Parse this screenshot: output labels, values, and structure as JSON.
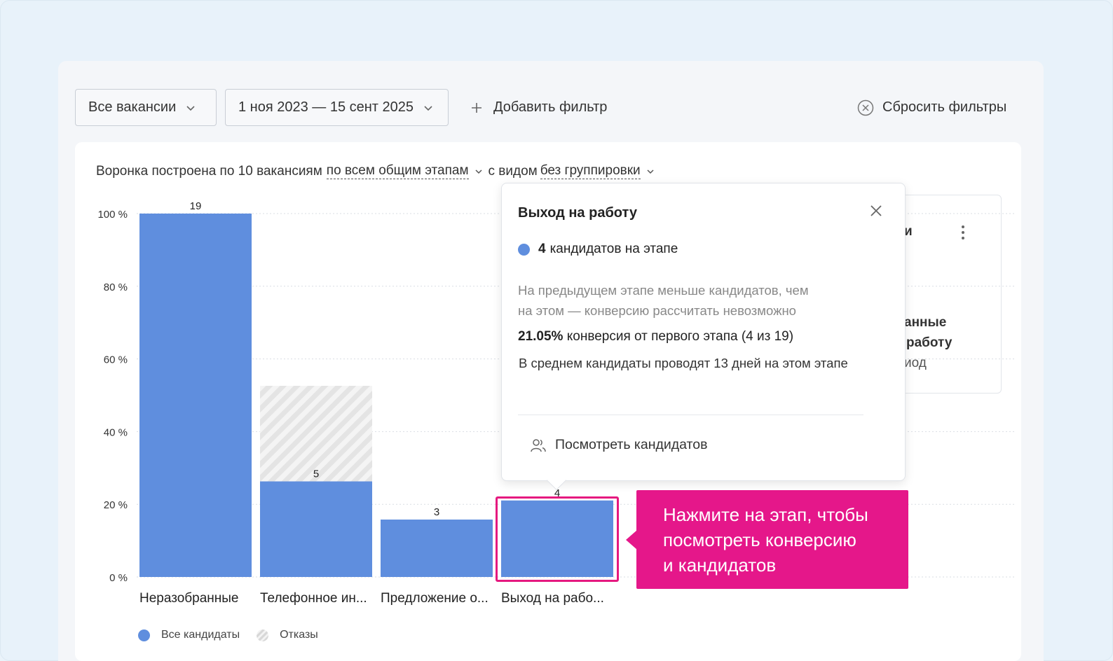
{
  "filters": {
    "vacancies": "Все вакансии",
    "dates": "1 ноя 2023 — 15 сент 2025",
    "add_filter": "Добавить фильтр",
    "reset_filters": "Сбросить фильтры"
  },
  "subtitle": {
    "prefix": "Воронка построена по 10 вакансиям",
    "stages_link": "по всем общим этапам",
    "middle": "с видом",
    "grouping_link": "без группировки"
  },
  "background_card": {
    "line1": "и",
    "line2": "анные",
    "line3": "работу",
    "line4": "иод"
  },
  "popup": {
    "title": "Выход на работу",
    "count_bold": "4",
    "count_text": "кандидатов на этапе",
    "note_line1": "На предыдущем этапе меньше кандидатов, чем",
    "note_line2": "на этом — конверсию рассчитать невозможно",
    "conv_bold": "21.05%",
    "conv_text": "конверсия от первого этапа (4 из 19)",
    "avg_text": "В среднем кандидаты проводят 13 дней на этом этапе",
    "action": "Посмотреть кандидатов"
  },
  "callout": {
    "line1": "Нажмите на этап, чтобы",
    "line2": "посмотреть конверсию",
    "line3": "и кандидатов"
  },
  "colors": {
    "bar": "#5f8ede",
    "accent": "#e5178a",
    "hatch": "#d8d8d8"
  },
  "chart_data": {
    "type": "bar",
    "categories": [
      "Неразобранные",
      "Телефонное ин...",
      "Предложение о...",
      "Выход на рабо..."
    ],
    "series": [
      {
        "name": "Все кандидаты",
        "values": [
          100,
          26.3,
          15.8,
          21.05
        ],
        "labels": [
          "19",
          "5",
          "3",
          "4"
        ]
      },
      {
        "name": "Отказы",
        "values": [
          0,
          26.3,
          0,
          0
        ]
      }
    ],
    "y_ticks": [
      "100 %",
      "80 %",
      "60 %",
      "40 %",
      "20 %",
      "0 %"
    ],
    "ylim": [
      0,
      100
    ],
    "grid": true,
    "legend": "bottom-left",
    "stacked": true
  }
}
